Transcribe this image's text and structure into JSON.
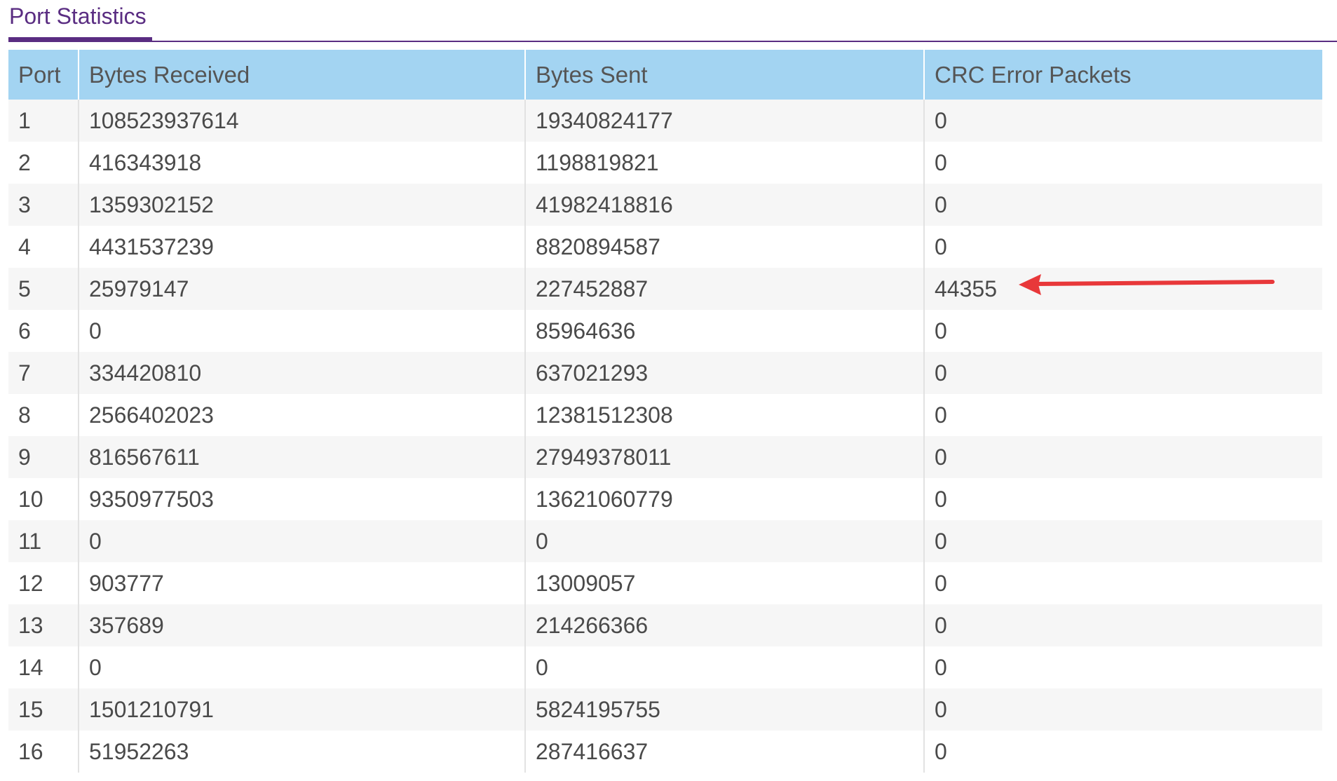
{
  "tabs": [
    {
      "label": "Port Statistics",
      "active": true
    }
  ],
  "table": {
    "columns": [
      "Port",
      "Bytes Received",
      "Bytes Sent",
      "CRC Error Packets"
    ],
    "rows": [
      [
        "1",
        "108523937614",
        "19340824177",
        "0"
      ],
      [
        "2",
        "416343918",
        "1198819821",
        "0"
      ],
      [
        "3",
        "1359302152",
        "41982418816",
        "0"
      ],
      [
        "4",
        "4431537239",
        "8820894587",
        "0"
      ],
      [
        "5",
        "25979147",
        "227452887",
        "44355"
      ],
      [
        "6",
        "0",
        "85964636",
        "0"
      ],
      [
        "7",
        "334420810",
        "637021293",
        "0"
      ],
      [
        "8",
        "2566402023",
        "12381512308",
        "0"
      ],
      [
        "9",
        "816567611",
        "27949378011",
        "0"
      ],
      [
        "10",
        "9350977503",
        "13621060779",
        "0"
      ],
      [
        "11",
        "0",
        "0",
        "0"
      ],
      [
        "12",
        "903777",
        "13009057",
        "0"
      ],
      [
        "13",
        "357689",
        "214266366",
        "0"
      ],
      [
        "14",
        "0",
        "0",
        "0"
      ],
      [
        "15",
        "1501210791",
        "5824195755",
        "0"
      ],
      [
        "16",
        "51952263",
        "287416637",
        "0"
      ]
    ]
  },
  "annotation": {
    "type": "arrow",
    "color": "#e8383a",
    "points_to": "CRC Error Packets, port 5"
  },
  "colors": {
    "accent": "#5a2d82",
    "header_bg": "#a3d4f2",
    "row_alt_bg": "#f6f6f6"
  }
}
